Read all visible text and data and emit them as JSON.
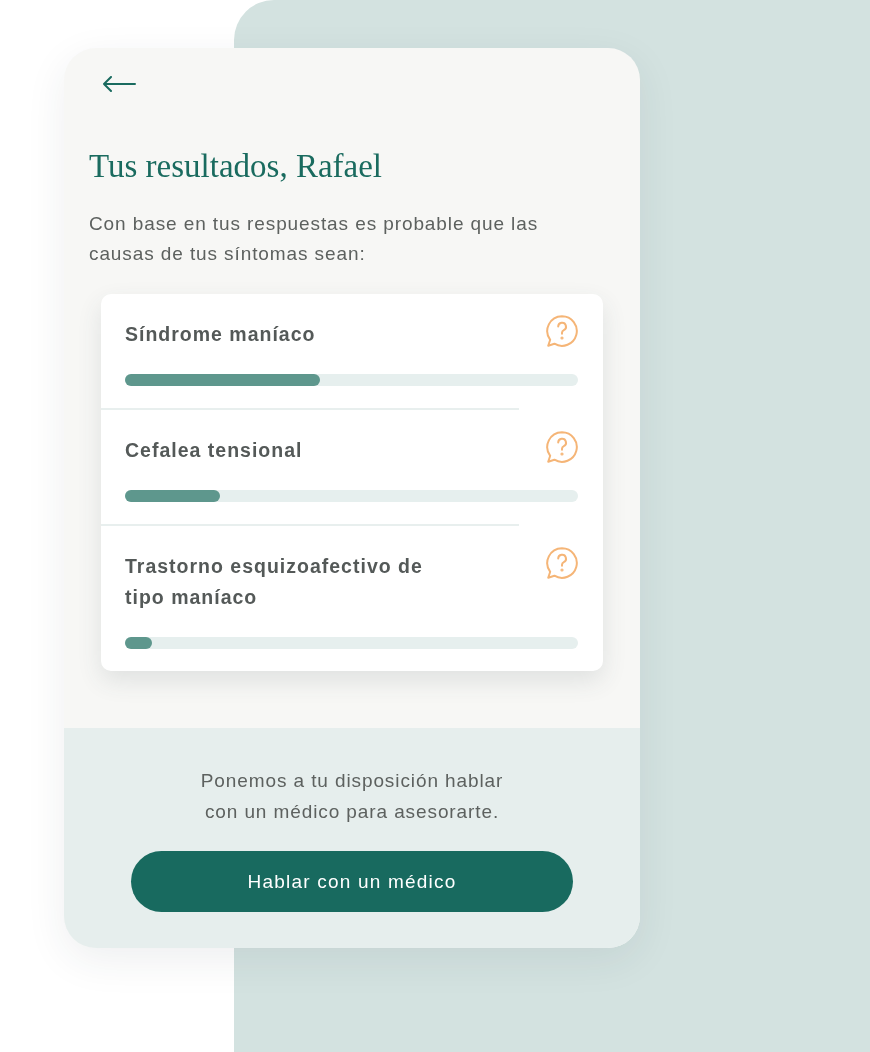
{
  "title": "Tus resultados, Rafael",
  "intro": "Con base en tus respuestas es probable que las causas de tus síntomas sean:",
  "results": [
    {
      "name": "Síndrome maníaco",
      "level": 0.43
    },
    {
      "name": "Cefalea tensional",
      "level": 0.21
    },
    {
      "name": "Trastorno esquizoafectivo de tipo maníaco",
      "level": 0.06
    }
  ],
  "footer": {
    "text": "Ponemos a tu disposición hablar con un médico para asesorarte.",
    "button": "Hablar con un médico"
  }
}
